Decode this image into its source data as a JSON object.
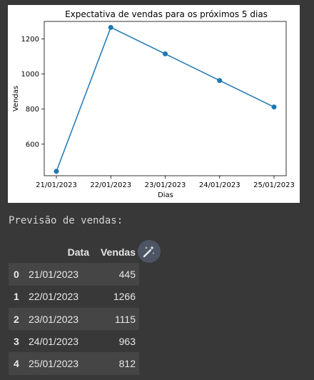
{
  "chart_data": {
    "type": "line",
    "title": "Expectativa de vendas para os próximos 5 dias",
    "xlabel": "Dias",
    "ylabel": "Vendas",
    "categories": [
      "21/01/2023",
      "22/01/2023",
      "23/01/2023",
      "24/01/2023",
      "25/01/2023"
    ],
    "series": [
      {
        "values": [
          445,
          1266,
          1115,
          963,
          812
        ]
      }
    ],
    "yticks": [
      600,
      800,
      1000,
      1200
    ],
    "ylim": [
      420,
      1300
    ],
    "grid": false,
    "color": "#1f77b4"
  },
  "output": {
    "label": "Previsão de vendas:"
  },
  "table": {
    "columns": [
      "",
      "Data",
      "Vendas"
    ],
    "rows": [
      {
        "index": "0",
        "data": "21/01/2023",
        "vendas": "445"
      },
      {
        "index": "1",
        "data": "22/01/2023",
        "vendas": "1266"
      },
      {
        "index": "2",
        "data": "23/01/2023",
        "vendas": "1115"
      },
      {
        "index": "3",
        "data": "24/01/2023",
        "vendas": "963"
      },
      {
        "index": "4",
        "data": "25/01/2023",
        "vendas": "812"
      }
    ]
  },
  "icons": {
    "wand": "magic-wand-icon"
  }
}
